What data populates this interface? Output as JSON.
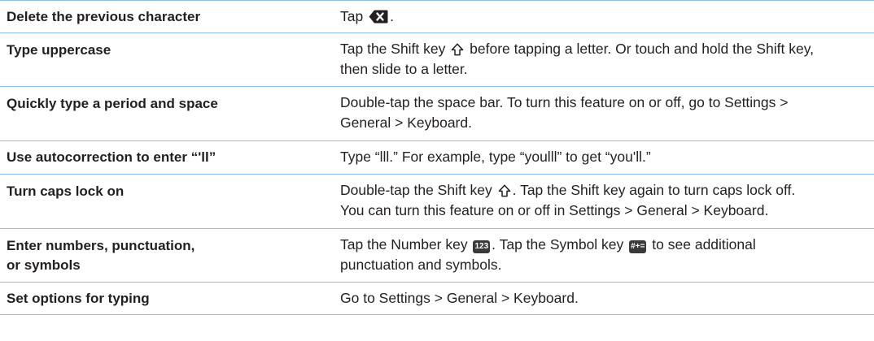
{
  "rows": [
    {
      "action": "Delete the previous character",
      "desc_before": "Tap",
      "desc_after": "."
    },
    {
      "action": "Type uppercase",
      "desc_before": "Tap the Shift key",
      "desc_after": "before tapping a letter. Or touch and hold the Shift key,",
      "desc_line2": "then slide to a letter."
    },
    {
      "action": "Quickly type a period and space",
      "desc_line1": "Double-tap the space bar. To turn this feature on or off, go to Settings >",
      "desc_line2": "General > Keyboard."
    },
    {
      "action": "Use autocorrection to enter “'ll”",
      "desc_line1": "Type “lll.” For example, type “youlll” to get “you'll.”"
    },
    {
      "action": "Turn caps lock on",
      "desc_before": "Double-tap the Shift key",
      "desc_after": ". Tap the Shift key again to turn caps lock off.",
      "desc_line2": "You can turn this feature on or off in Settings > General > Keyboard."
    },
    {
      "action_line1": "Enter numbers, punctuation,",
      "action_line2": "or symbols",
      "desc_before": "Tap the Number key",
      "number_key_label": "123",
      "desc_middle": ". Tap the Symbol key",
      "symbol_key_label": "#+=",
      "desc_after": "to see additional",
      "desc_line2": "punctuation and symbols."
    },
    {
      "action": "Set options for typing",
      "desc_line1": "Go to Settings > General > Keyboard."
    }
  ],
  "icons": {
    "delete_key": "delete-key-icon",
    "shift_key": "shift-arrow-icon"
  },
  "colors": {
    "rule": "#8ec3e6",
    "text": "#231f20",
    "key_fill": "#3a3a3a"
  }
}
